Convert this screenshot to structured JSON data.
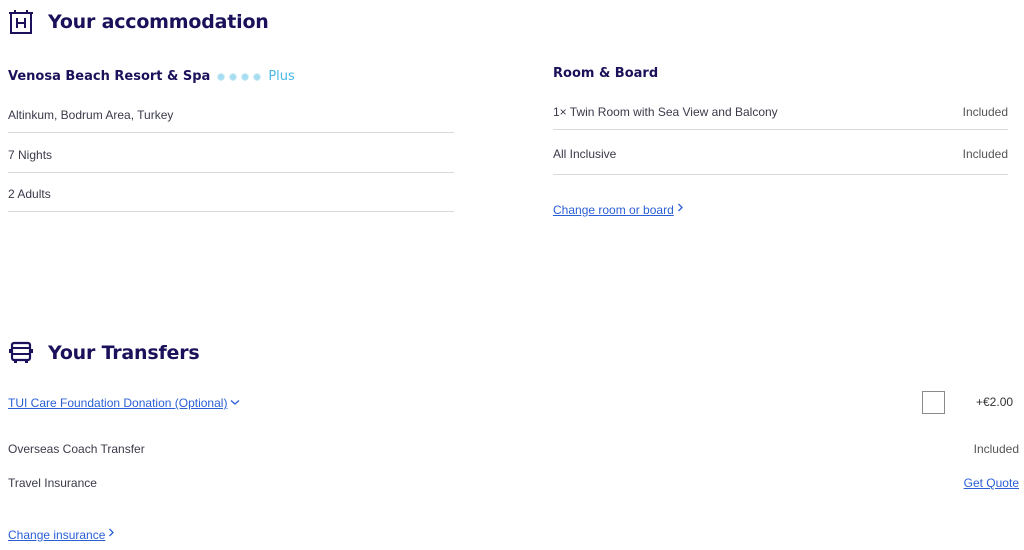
{
  "accommodation": {
    "title": "Your accommodation",
    "hotel_name": "Venosa Beach Resort & Spa",
    "rating_plus": "Plus",
    "details": {
      "location": "Altinkum, Bodrum Area, Turkey",
      "nights": "7 Nights",
      "adults": "2  Adults"
    },
    "room_board": {
      "title": "Room & Board",
      "room_label": "1× Twin Room with Sea View and Balcony",
      "room_status": "Included",
      "board_label": "All Inclusive",
      "board_status": "Included",
      "change_link": "Change room or board"
    }
  },
  "transfers": {
    "title": "Your Transfers",
    "donation_link": "TUI Care Foundation Donation (Optional)",
    "donation_price": "+€2.00",
    "coach_label": "Overseas Coach Transfer",
    "coach_status": "Included",
    "insurance_label": "Travel Insurance",
    "insurance_action": "Get Quote",
    "change_insurance_link": "Change insurance"
  },
  "icons": {
    "hotel": "hotel-icon",
    "bus": "bus-icon",
    "star": "star-icon",
    "chevron_right": "chevron-right-icon",
    "chevron_down": "chevron-down-icon"
  },
  "colors": {
    "heading": "#1a115a",
    "link": "#2a5fd6",
    "plus": "#4ab8e6",
    "divider": "#d9d9df"
  }
}
